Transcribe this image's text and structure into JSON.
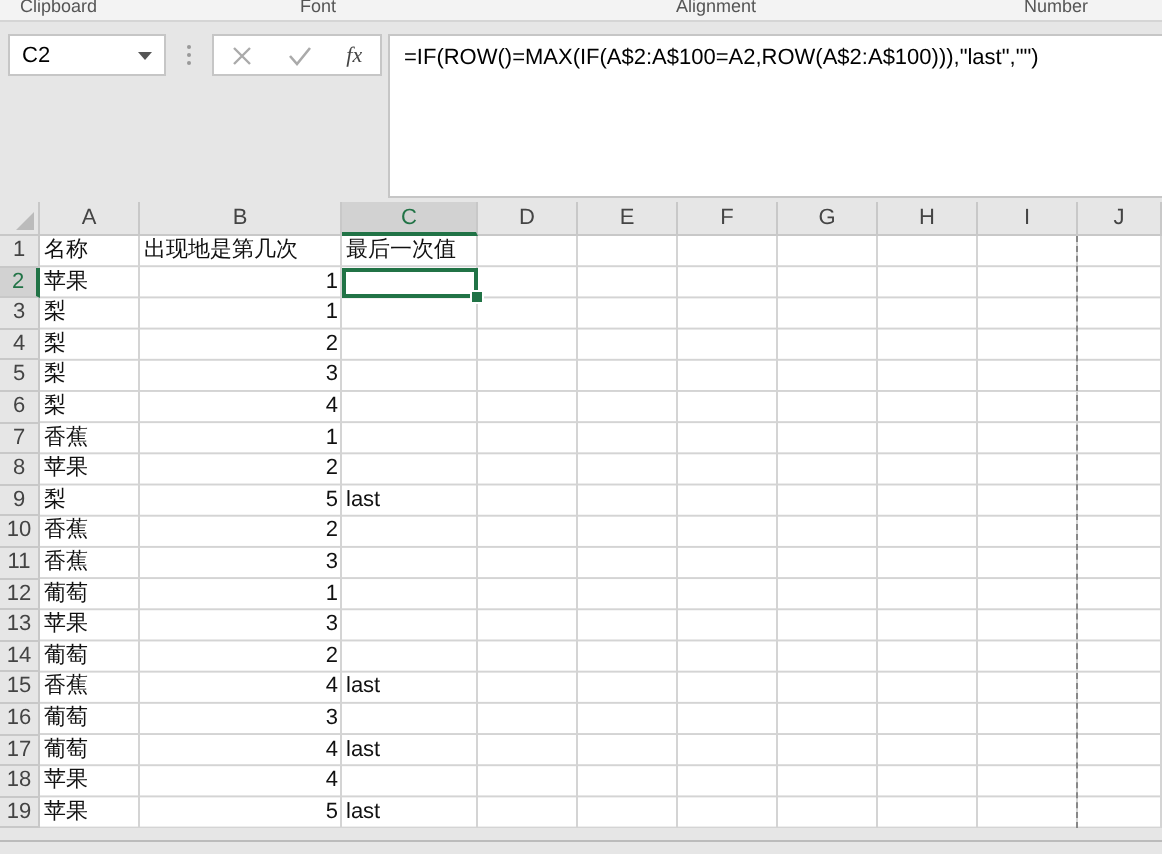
{
  "ribbon_groups": [
    "Clipboard",
    "Font",
    "Alignment",
    "Number"
  ],
  "name_box": {
    "value": "C2"
  },
  "formula_bar": {
    "fx": "fx",
    "value": "=IF(ROW()=MAX(IF(A$2:A$100=A2,ROW(A$2:A$100))),\"last\",\"\")"
  },
  "columns": [
    {
      "label": "A",
      "selected": false
    },
    {
      "label": "B",
      "selected": false
    },
    {
      "label": "C",
      "selected": true
    },
    {
      "label": "D",
      "selected": false
    },
    {
      "label": "E",
      "selected": false
    },
    {
      "label": "F",
      "selected": false
    },
    {
      "label": "G",
      "selected": false
    },
    {
      "label": "H",
      "selected": false
    },
    {
      "label": "I",
      "selected": false
    },
    {
      "label": "J",
      "selected": false
    }
  ],
  "rows": [
    {
      "number": "1",
      "selected": false,
      "cells": [
        "名称",
        "出现地是第几次",
        "最后一次值"
      ]
    },
    {
      "number": "2",
      "selected": true,
      "cells": [
        "苹果",
        "1",
        ""
      ]
    },
    {
      "number": "3",
      "selected": false,
      "cells": [
        "梨",
        "1",
        ""
      ]
    },
    {
      "number": "4",
      "selected": false,
      "cells": [
        "梨",
        "2",
        ""
      ]
    },
    {
      "number": "5",
      "selected": false,
      "cells": [
        "梨",
        "3",
        ""
      ]
    },
    {
      "number": "6",
      "selected": false,
      "cells": [
        "梨",
        "4",
        ""
      ]
    },
    {
      "number": "7",
      "selected": false,
      "cells": [
        "香蕉",
        "1",
        ""
      ]
    },
    {
      "number": "8",
      "selected": false,
      "cells": [
        "苹果",
        "2",
        ""
      ]
    },
    {
      "number": "9",
      "selected": false,
      "cells": [
        "梨",
        "5",
        "last"
      ]
    },
    {
      "number": "10",
      "selected": false,
      "cells": [
        "香蕉",
        "2",
        ""
      ]
    },
    {
      "number": "11",
      "selected": false,
      "cells": [
        "香蕉",
        "3",
        ""
      ]
    },
    {
      "number": "12",
      "selected": false,
      "cells": [
        "葡萄",
        "1",
        ""
      ]
    },
    {
      "number": "13",
      "selected": false,
      "cells": [
        "苹果",
        "3",
        ""
      ]
    },
    {
      "number": "14",
      "selected": false,
      "cells": [
        "葡萄",
        "2",
        ""
      ]
    },
    {
      "number": "15",
      "selected": false,
      "cells": [
        "香蕉",
        "4",
        "last"
      ]
    },
    {
      "number": "16",
      "selected": false,
      "cells": [
        "葡萄",
        "3",
        ""
      ]
    },
    {
      "number": "17",
      "selected": false,
      "cells": [
        "葡萄",
        "4",
        "last"
      ]
    },
    {
      "number": "18",
      "selected": false,
      "cells": [
        "苹果",
        "4",
        ""
      ]
    },
    {
      "number": "19",
      "selected": false,
      "cells": [
        "苹果",
        "5",
        "last"
      ]
    }
  ]
}
